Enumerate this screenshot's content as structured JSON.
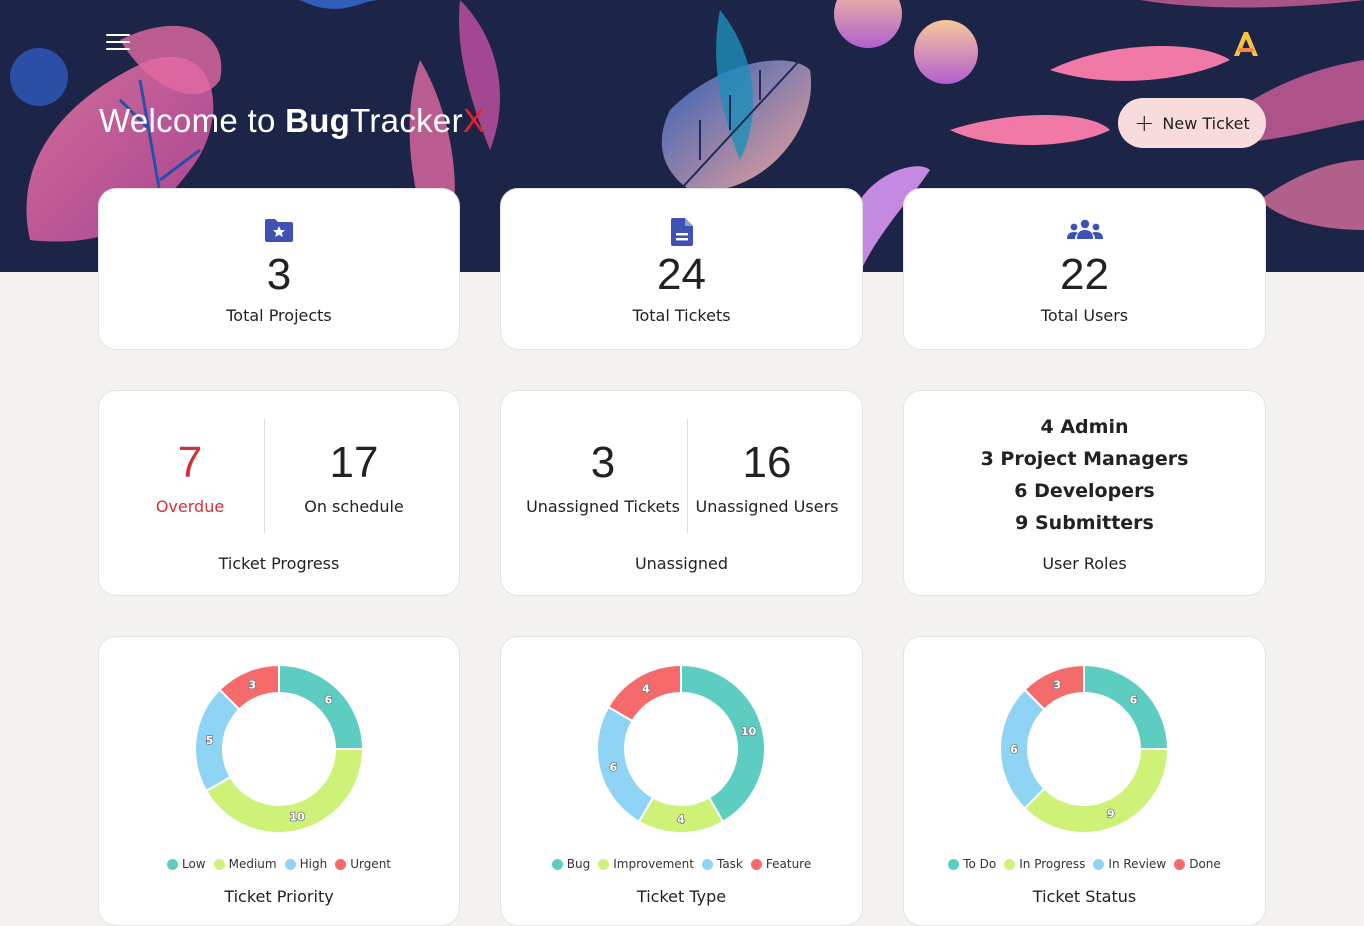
{
  "header": {
    "welcome_prefix": "Welcome to ",
    "brand_bold": "Bug",
    "brand_regular": "Tracker",
    "brand_accent": "X",
    "new_ticket_label": "New Ticket",
    "accent_color": "#e8212b"
  },
  "stats": [
    {
      "value": "3",
      "label": "Total Projects",
      "icon": "folder-star-icon"
    },
    {
      "value": "24",
      "label": "Total Tickets",
      "icon": "document-icon"
    },
    {
      "value": "22",
      "label": "Total Users",
      "icon": "users-group-icon"
    }
  ],
  "ticket_progress": {
    "overdue_value": "7",
    "overdue_label": "Overdue",
    "schedule_value": "17",
    "schedule_label": "On schedule",
    "title": "Ticket Progress"
  },
  "unassigned": {
    "tickets_value": "3",
    "tickets_label": "Unassigned Tickets",
    "users_value": "16",
    "users_label": "Unassigned Users",
    "title": "Unassigned"
  },
  "user_roles": {
    "lines": [
      "4 Admin",
      "3 Project Managers",
      "6 Developers",
      "9 Submitters"
    ],
    "title": "User Roles"
  },
  "chart_data": [
    {
      "type": "pie",
      "donut": true,
      "title": "Ticket Priority",
      "categories": [
        "Low",
        "Medium",
        "High",
        "Urgent"
      ],
      "values": [
        6,
        10,
        5,
        3
      ],
      "colors": [
        "#5ccdc0",
        "#cdf277",
        "#8fd4f5",
        "#f56b6b"
      ],
      "legend": "bottom"
    },
    {
      "type": "pie",
      "donut": true,
      "title": "Ticket Type",
      "categories": [
        "Bug",
        "Improvement",
        "Task",
        "Feature"
      ],
      "values": [
        10,
        4,
        6,
        4
      ],
      "colors": [
        "#5ccdc0",
        "#cdf277",
        "#8fd4f5",
        "#f56b6b"
      ],
      "legend": "bottom"
    },
    {
      "type": "pie",
      "donut": true,
      "title": "Ticket Status",
      "categories": [
        "To Do",
        "In Progress",
        "In Review",
        "Done"
      ],
      "values": [
        6,
        9,
        6,
        3
      ],
      "colors": [
        "#5ccdc0",
        "#cdf277",
        "#8fd4f5",
        "#f56b6b"
      ],
      "legend": "bottom"
    }
  ]
}
